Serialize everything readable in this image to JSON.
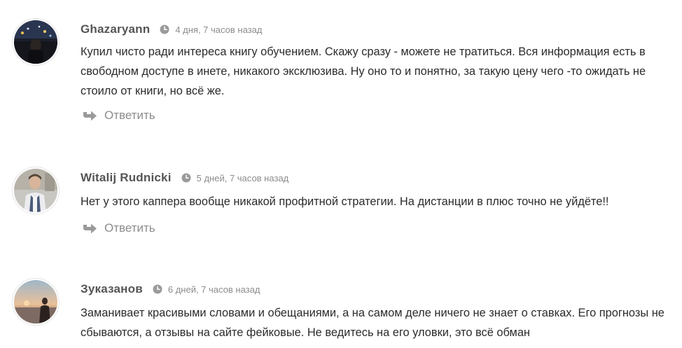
{
  "comments": [
    {
      "author": "Ghazaryann",
      "date": "4 дня, 7 часов назад",
      "text": "Купил чисто ради интереса книгу обучением. Скажу сразу - можете не тратиться. Вся информация есть в свободном доступе в инете, никакого эксклюзива. Ну оно то и понятно, за такую цену чего -то ожидать не стоило от книги, но всё же.",
      "reply_label": "Ответить"
    },
    {
      "author": "Witalij Rudnicki",
      "date": "5 дней, 7 часов назад",
      "text": "Нет у этого каппера вообще никакой профитной стратегии. На дистанции в плюс точно не уйдёте!!",
      "reply_label": "Ответить"
    },
    {
      "author": "Зуказанов",
      "date": "6 дней, 7 часов назад",
      "text": "Заманивает красивыми словами и обещаниями, а на самом деле ничего не знает о ставках. Его прогнозы не сбываются, а отзывы на сайте фейковые. Не ведитесь на его уловки, это всё обман"
    }
  ],
  "colors": {
    "author": "#555555",
    "date": "#8c8c8c",
    "text": "#2b2b2b",
    "icon": "#9a9a9a"
  },
  "icons": {
    "time": "clock-icon",
    "reply": "reply-arrow-icon"
  }
}
